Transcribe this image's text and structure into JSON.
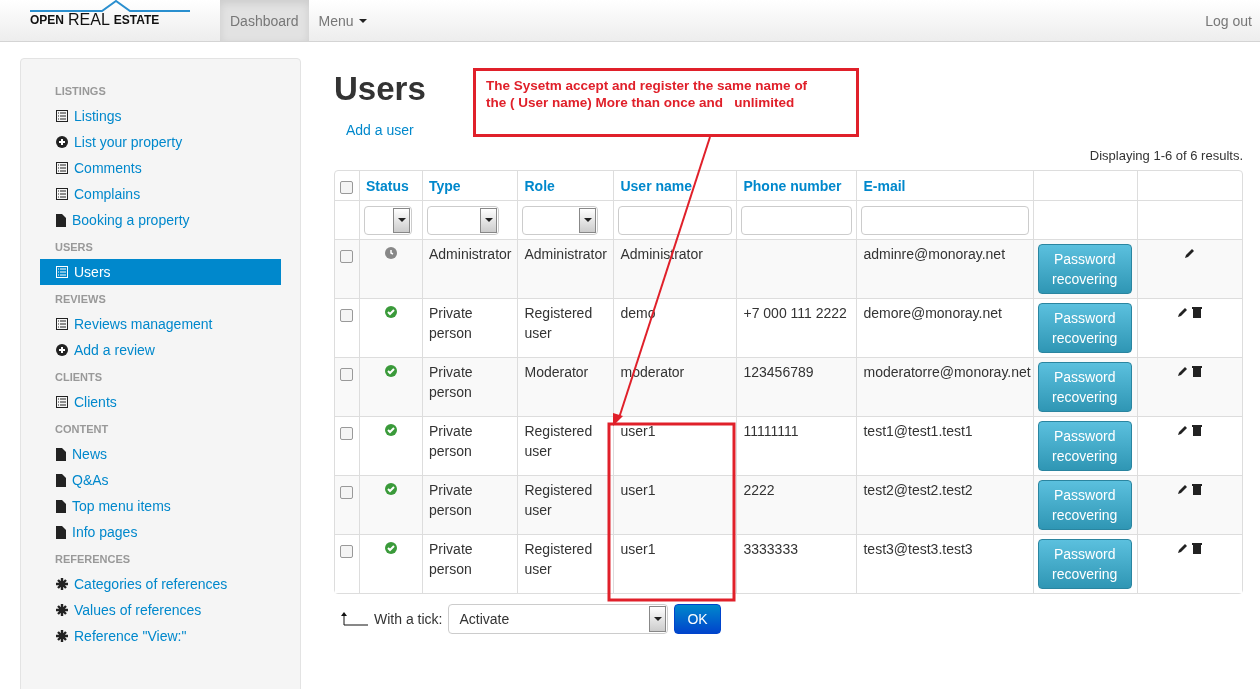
{
  "navbar": {
    "logo": {
      "word_1": "OPEN",
      "word_2": "REAL",
      "word_3": "ESTATE"
    },
    "items": [
      {
        "label": "Dashboard",
        "selected": true,
        "kind": "link"
      },
      {
        "label": "Menu",
        "selected": false,
        "kind": "dropdown"
      }
    ],
    "logout": "Log out"
  },
  "sidebar": {
    "sections": [
      {
        "title": "LISTINGS",
        "items": [
          {
            "label": "Listings",
            "kind": "list",
            "selected": false
          },
          {
            "label": "List your property",
            "kind": "add",
            "selected": false
          },
          {
            "label": "Comments",
            "kind": "list",
            "selected": false
          },
          {
            "label": "Complains",
            "kind": "list",
            "selected": false
          },
          {
            "label": "Booking a property",
            "kind": "page",
            "selected": false
          }
        ]
      },
      {
        "title": "USERS",
        "items": [
          {
            "label": "Users",
            "kind": "list",
            "selected": true
          }
        ]
      },
      {
        "title": "REVIEWS",
        "items": [
          {
            "label": "Reviews management",
            "kind": "list",
            "selected": false
          },
          {
            "label": "Add a review",
            "kind": "add",
            "selected": false
          }
        ]
      },
      {
        "title": "CLIENTS",
        "items": [
          {
            "label": "Clients",
            "kind": "list",
            "selected": false
          }
        ]
      },
      {
        "title": "CONTENT",
        "items": [
          {
            "label": "News",
            "kind": "page",
            "selected": false
          },
          {
            "label": "Q&As",
            "kind": "page",
            "selected": false
          },
          {
            "label": "Top menu items",
            "kind": "page",
            "selected": false
          },
          {
            "label": "Info pages",
            "kind": "page",
            "selected": false
          }
        ]
      },
      {
        "title": "REFERENCES",
        "items": [
          {
            "label": "Categories of references",
            "kind": "reference",
            "selected": false
          },
          {
            "label": "Values of references",
            "kind": "reference",
            "selected": false
          },
          {
            "label": "Reference \"View:\"",
            "kind": "reference",
            "selected": false
          }
        ]
      }
    ]
  },
  "page": {
    "title": "Users",
    "add_link": "Add a user",
    "summary": "Displaying 1-6 of 6 results."
  },
  "table": {
    "select_all_checked": false,
    "columns": [
      "Status",
      "Type",
      "Role",
      "User name",
      "Phone number",
      "E-mail"
    ],
    "rows": [
      {
        "checked": false,
        "active": false,
        "type": "Administrator",
        "role": "Administrator",
        "user_name": "Administrator",
        "phone": "",
        "email": "adminre@monoray.net",
        "button": "Password recovering",
        "deletable": false
      },
      {
        "checked": false,
        "active": true,
        "type": "Private person",
        "role": "Registered user",
        "user_name": "demo",
        "phone": "+7 000 111 2222",
        "email": "demore@monoray.net",
        "button": "Password recovering",
        "deletable": true
      },
      {
        "checked": false,
        "active": true,
        "type": "Private person",
        "role": "Moderator",
        "user_name": "moderator",
        "phone": "123456789",
        "email": "moderatorre@monoray.net",
        "button": "Password recovering",
        "deletable": true
      },
      {
        "checked": false,
        "active": true,
        "type": "Private person",
        "role": "Registered user",
        "user_name": "user1",
        "phone": "11111111",
        "email": "test1@test1.test1",
        "button": "Password recovering",
        "deletable": true
      },
      {
        "checked": false,
        "active": true,
        "type": "Private person",
        "role": "Registered user",
        "user_name": "user1",
        "phone": "2222",
        "email": "test2@test2.test2",
        "button": "Password recovering",
        "deletable": true
      },
      {
        "checked": false,
        "active": true,
        "type": "Private person",
        "role": "Registered user",
        "user_name": "user1",
        "phone": "3333333",
        "email": "test3@test3.test3",
        "button": "Password recovering",
        "deletable": true
      }
    ]
  },
  "bulk_action": {
    "label": "With a tick:",
    "value": "Activate",
    "button": "OK"
  },
  "annotation": {
    "text": "The Sysetm accept and register the same name of the ( User name) More than once and   unlimited"
  }
}
